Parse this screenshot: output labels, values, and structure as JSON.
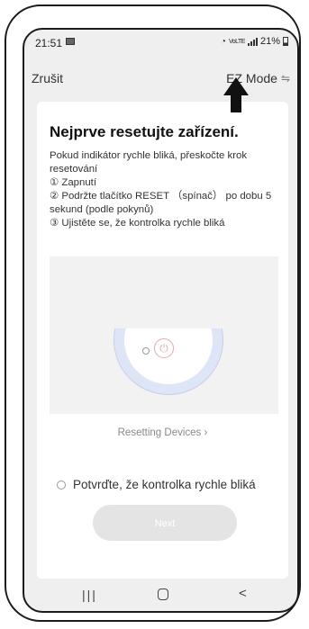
{
  "status_bar": {
    "time": "21:51",
    "volte": "VoLTE",
    "battery": "21%"
  },
  "header": {
    "cancel": "Zrušit",
    "mode": "EZ Mode",
    "mode_icon": "swap-arrows-icon"
  },
  "card": {
    "title": "Nejprve resetujte zařízení.",
    "lines": [
      "Pokud indikátor rychle bliká, přeskočte krok resetování",
      "① Zapnutí",
      "② Podržte tlačítko RESET （spínač） po dobu 5 sekund (podle pokynů)",
      "③ Ujistěte se, že kontrolka rychle bliká"
    ],
    "resetting_link": "Resetting Devices",
    "confirm_label": "Potvrďte, že kontrolka rychle bliká",
    "next_button": "Next"
  },
  "colors": {
    "card_bg": "#ffffff",
    "screen_bg": "#efefef",
    "button_disabled": "#e4e4e4",
    "device_ring": "#dde5f6",
    "power_icon": "#e6a9a9"
  },
  "system_nav": {
    "recent_icon": "recent-apps-icon",
    "home_icon": "home-icon",
    "back_icon": "back-icon"
  }
}
